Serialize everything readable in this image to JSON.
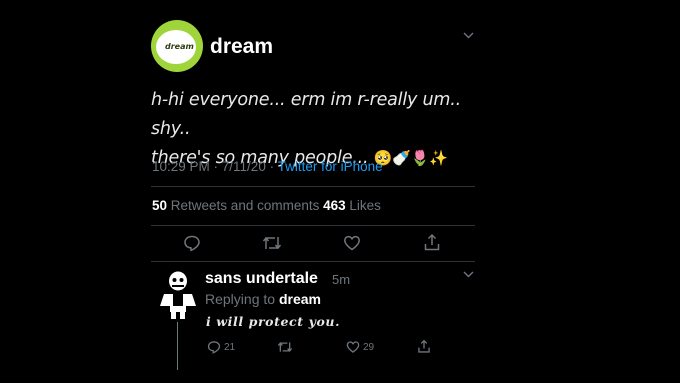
{
  "main_tweet": {
    "author": "dream",
    "avatar_text": "dream",
    "line1": "h-hi everyone... erm im r-really um.. shy..",
    "line2": "there's so many people...",
    "emojis": "🥺🍼🌷✨",
    "time": "10:29 PM · 7/11/20 · ",
    "source": "Twitter for iPhone",
    "retweets_count": "50",
    "retweets_label": " Retweets and comments ",
    "likes_count": "463",
    "likes_label": " Likes"
  },
  "reply_tweet": {
    "author": "sans undertale",
    "time": "5m",
    "replying_prefix": "Replying to ",
    "replying_to": "dream",
    "text": "i will protect you.",
    "reply_count": "21",
    "like_count": "29"
  },
  "colors": {
    "background": "#000000",
    "muted": "#6e767d",
    "link": "#1d9bf0",
    "avatar_green": "#9fd43a"
  },
  "icons": [
    "chevron-down-icon",
    "reply-icon",
    "retweet-icon",
    "like-icon",
    "share-icon"
  ]
}
